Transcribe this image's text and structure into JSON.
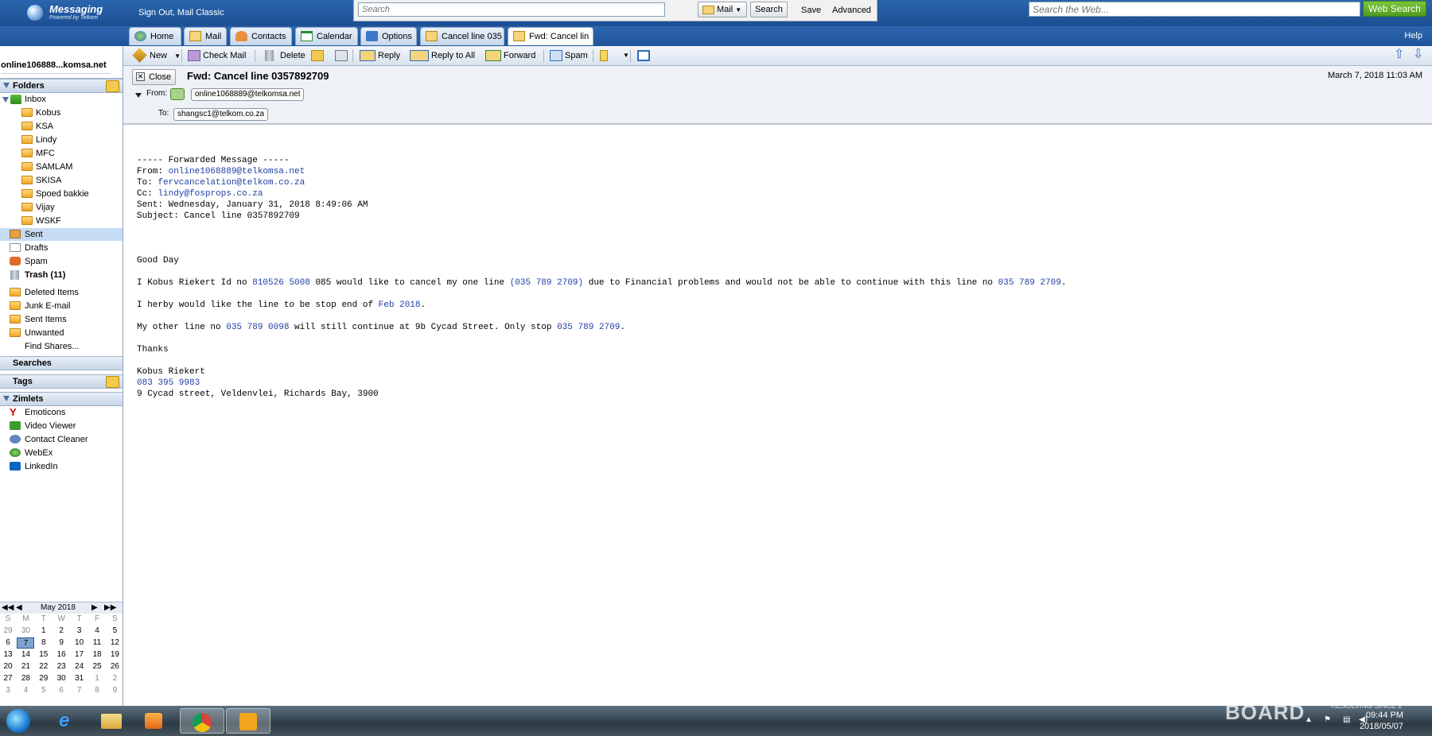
{
  "header": {
    "logo_title": "Messaging",
    "logo_subtitle": "Powered by Telkom",
    "signout": "Sign Out, Mail Classic",
    "search_placeholder": "Search",
    "mail_select": "Mail",
    "search_btn": "Search",
    "save_link": "Save",
    "advanced_link": "Advanced",
    "web_placeholder": "Search the Web...",
    "web_btn": "Web Search"
  },
  "tabs": [
    {
      "label": "Home"
    },
    {
      "label": "Mail"
    },
    {
      "label": "Contacts"
    },
    {
      "label": "Calendar"
    },
    {
      "label": "Options"
    },
    {
      "label": "Cancel line 035"
    },
    {
      "label": "Fwd: Cancel lin"
    }
  ],
  "help": "Help",
  "account": "online106888...komsa.net",
  "folders_header": "Folders",
  "folders": {
    "inbox": "Inbox",
    "subfolders": [
      "Kobus",
      "KSA",
      "Lindy",
      "MFC",
      "SAMLAM",
      "SKISA",
      "Spoed bakkie",
      "Vijay",
      "WSKF"
    ],
    "sent": "Sent",
    "drafts": "Drafts",
    "spam": "Spam",
    "trash": "Trash (11)",
    "deleted": "Deleted Items",
    "junk": "Junk E-mail",
    "sentitems": "Sent Items",
    "unwanted": "Unwanted",
    "findshares": "Find Shares..."
  },
  "searches_header": "Searches",
  "tags_header": "Tags",
  "zimlets_header": "Zimlets",
  "zimlets": [
    "Emoticons",
    "Video Viewer",
    "Contact Cleaner",
    "WebEx",
    "LinkedIn"
  ],
  "calendar": {
    "month": "May 2018",
    "dow": [
      "S",
      "M",
      "T",
      "W",
      "T",
      "F",
      "S"
    ],
    "weeks": [
      [
        "29",
        "30",
        "1",
        "2",
        "3",
        "4",
        "5"
      ],
      [
        "6",
        "7",
        "8",
        "9",
        "10",
        "11",
        "12"
      ],
      [
        "13",
        "14",
        "15",
        "16",
        "17",
        "18",
        "19"
      ],
      [
        "20",
        "21",
        "22",
        "23",
        "24",
        "25",
        "26"
      ],
      [
        "27",
        "28",
        "29",
        "30",
        "31",
        "1",
        "2"
      ],
      [
        "3",
        "4",
        "5",
        "6",
        "7",
        "8",
        "9"
      ]
    ],
    "today": "7"
  },
  "toolbar": {
    "new": "New",
    "check_mail": "Check Mail",
    "delete": "Delete",
    "reply": "Reply",
    "reply_all": "Reply to All",
    "forward": "Forward",
    "spam": "Spam"
  },
  "message": {
    "close": "Close",
    "subject": "Fwd: Cancel line 0357892709",
    "date": "March 7, 2018 11:03 AM",
    "from_label": "From:",
    "from": "online1068889@telkomsa.net",
    "to_label": "To:",
    "to": "shangsc1@telkom.co.za",
    "body": {
      "fwd_line": "----- Forwarded Message -----",
      "from_pre": "From: ",
      "from_addr": "online1068889@telkomsa.net",
      "to_pre": "To: ",
      "to_addr": "fervcancelation@telkom.co.za",
      "cc_pre": "Cc: ",
      "cc_addr": "lindy@fosprops.co.za",
      "sent": "Sent: Wednesday, January 31, 2018 8:49:06 AM",
      "subj": "Subject: Cancel line 0357892709",
      "greeting": "Good Day",
      "p1_a": "I Kobus Riekert Id no ",
      "p1_b": "810526 5008",
      "p1_c": " 085 would like to cancel my one line ",
      "p1_d": "(035 789 2709)",
      "p1_e": " due to Financial problems and would not be able to continue with this line no ",
      "p1_f": "035 789 2709",
      "p1_g": ".",
      "p2_a": "I herby would like the line to be stop end of ",
      "p2_b": "Feb 2018",
      "p2_c": ".",
      "p3_a": "My other line no ",
      "p3_b": "035 789 0098",
      "p3_c": " will still continue at 9b Cycad Street. Only stop ",
      "p3_d": "035 789 2709",
      "p3_e": ".",
      "thanks": "Thanks",
      "sig_name": "Kobus Riekert",
      "sig_phone": "083 395 9983",
      "sig_addr": "9 Cycad street, Veldenvlei, Richards Bay, 3900"
    }
  },
  "taskbar": {
    "time": "09:44 PM",
    "date": "2018/05/07",
    "watermark": "BOARD",
    "watermark_sub": "RESOLVING SINCE 2"
  },
  "colors": {
    "accent": "#1f5399",
    "link": "#1f3fa5",
    "selected": "#c5dcf3"
  }
}
